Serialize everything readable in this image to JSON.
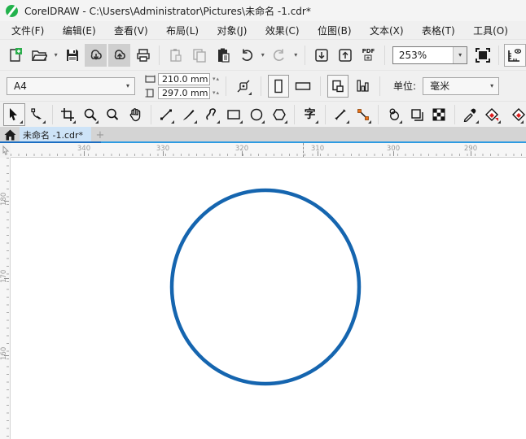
{
  "titlebar": {
    "title": "CorelDRAW - C:\\Users\\Administrator\\Pictures\\未命名 -1.cdr*"
  },
  "menubar": {
    "items": [
      "文件(F)",
      "编辑(E)",
      "查看(V)",
      "布局(L)",
      "对象(J)",
      "效果(C)",
      "位图(B)",
      "文本(X)",
      "表格(T)",
      "工具(O)"
    ]
  },
  "toolbar": {
    "zoom_level": "253%",
    "pdf_label": "PDF"
  },
  "property_bar": {
    "page_preset": "A4",
    "page_width": "210.0 mm",
    "page_height": "297.0 mm",
    "units_label": "单位:",
    "units_value": "毫米"
  },
  "toolbox": {
    "text_tool_glyph": "字"
  },
  "tabbar": {
    "active_tab": "未命名 -1.cdr*",
    "new_tab_label": "+"
  },
  "rulers": {
    "horizontal": [
      "340",
      "330",
      "320",
      "310",
      "300",
      "290"
    ],
    "vertical": [
      "180",
      "170",
      "160"
    ]
  },
  "canvas": {
    "circle_stroke": "#1565af",
    "circle_stroke_width": "4.5"
  },
  "colors": {
    "active_tab_bg": "#cde3f7",
    "tab_underline_blue": "#2d9be2",
    "logo_green": "#22b24c",
    "connector_orange": "#e8711a",
    "smart_fill_red": "#dd1f1f",
    "new_doc_green": "#2eae4e"
  }
}
